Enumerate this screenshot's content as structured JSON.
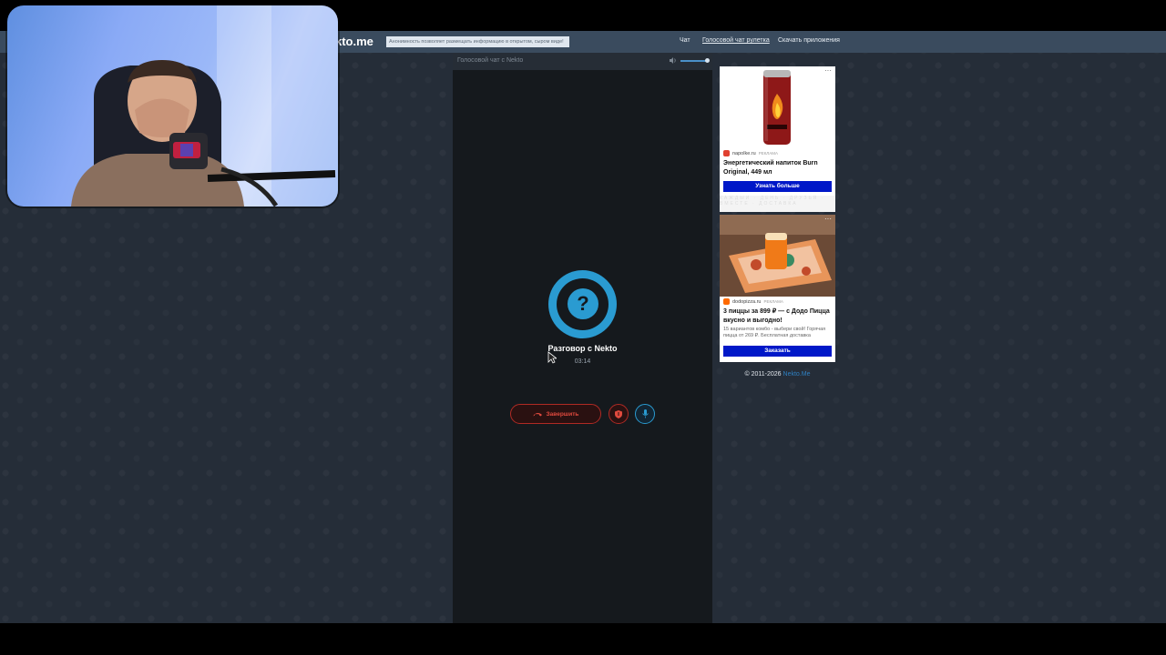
{
  "site": {
    "logo": "kto.me",
    "notice": "Анонимность позволяет размещать информацию в открытом, сыром виде!"
  },
  "nav": [
    {
      "label": "Чат"
    },
    {
      "label": "Голосовой чат рулетка"
    },
    {
      "label": "Скачать приложения"
    }
  ],
  "chat": {
    "title": "Голосовой чат с Nekto",
    "avatar_symbol": "?",
    "conversation_label": "Разговор с Nekto",
    "timer": "03:14",
    "end_button": "Завершить"
  },
  "ads": [
    {
      "source": "napolke.ru",
      "badge": "РЕКЛАМА",
      "title": "Энергетический напиток Burn Original, 449 мл",
      "button": "Узнать больше",
      "strip": "КАЖДЫЙ · ДЕНЬ · ДРУЗЬЯ · ВМЕСТЕ · ДОСТАВКА"
    },
    {
      "source": "dodopizza.ru",
      "badge": "РЕКЛАМА",
      "title": "3 пиццы за 899 ₽ — с Додо Пицца вкусно и выгодно!",
      "desc": "15 вариантов комбо - выбери свой! Горячая пицца от 269 ₽. Бесплатная доставка",
      "button": "Заказать"
    }
  ],
  "footer": {
    "copyright": "© 2011-2026 ",
    "link": "Nekto.Me"
  },
  "colors": {
    "accent": "#2a9bd1",
    "danger": "#b02a24",
    "ad_button": "#0018c8",
    "page_bg": "#252d38",
    "topbar": "#3a4b5e"
  }
}
